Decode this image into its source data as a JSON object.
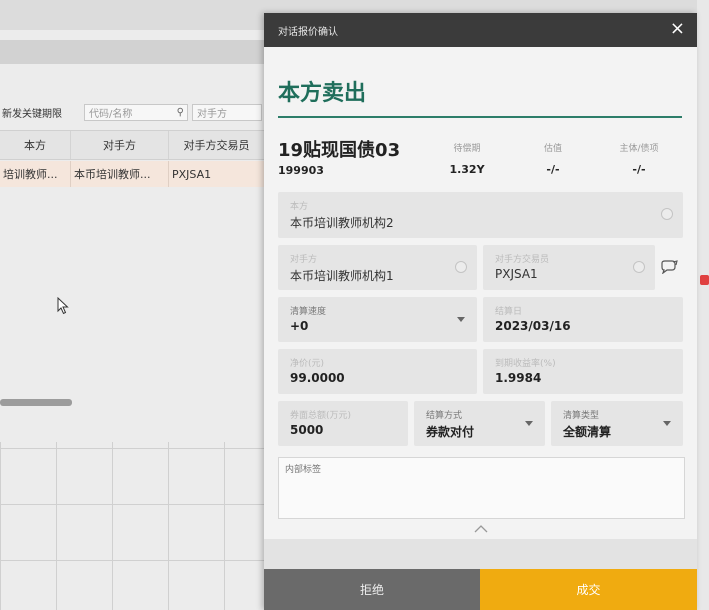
{
  "background": {
    "filter": {
      "label": "新发关键期限",
      "code_placeholder": "代码/名称",
      "counterparty_placeholder": "对手方"
    },
    "table": {
      "headers": [
        "本方",
        "对手方",
        "对手方交易员"
      ],
      "rows": [
        [
          "培训教师...",
          "本币培训教师...",
          "PXJSA1"
        ]
      ]
    }
  },
  "dialog": {
    "header_title": "对话报价确认",
    "close_label": "×",
    "direction_title": "本方卖出",
    "bond": {
      "name": "19贴现国债03",
      "code": "199903"
    },
    "stats": [
      {
        "label": "待偿期",
        "value": "1.32Y"
      },
      {
        "label": "估值",
        "value": "-/-"
      },
      {
        "label": "主体/债项",
        "value": "-/-"
      }
    ],
    "fields": {
      "own_party": {
        "label": "本方",
        "value": "本币培训教师机构2"
      },
      "counterparty": {
        "label": "对手方",
        "value": "本币培训教师机构1"
      },
      "counterparty_trader": {
        "label": "对手方交易员",
        "value": "PXJSA1"
      },
      "settlement_speed": {
        "label": "清算速度",
        "value": "+0"
      },
      "settlement_date": {
        "label": "结算日",
        "value": "2023/03/16"
      },
      "net_price": {
        "label": "净价(元)",
        "value": "99.0000"
      },
      "yield_to_maturity": {
        "label": "到期收益率(%)",
        "value": "1.9984"
      },
      "face_amount": {
        "label": "券面总额(万元)",
        "value": "5000"
      },
      "settlement_method": {
        "label": "结算方式",
        "value": "券款对付"
      },
      "clearing_type": {
        "label": "清算类型",
        "value": "全额清算"
      }
    },
    "memo_placeholder": "内部标签",
    "buttons": {
      "reject": "拒绝",
      "deal": "成交"
    }
  },
  "colors": {
    "accent_green": "#1f6e5b",
    "deal_button": "#f0ab10",
    "reject_button": "#6a6a6a",
    "header_bar": "#3b3b3b"
  }
}
